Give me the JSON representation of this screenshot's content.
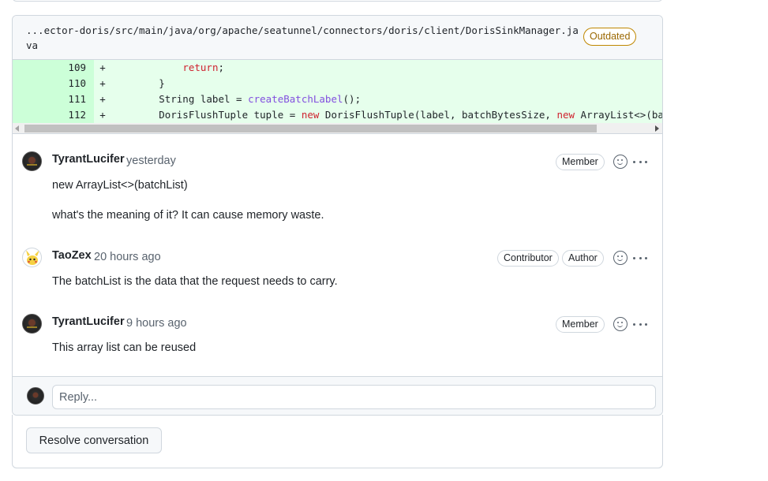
{
  "file": {
    "path": "...ector-doris/src/main/java/org/apache/seatunnel/connectors/doris/client/DorisSinkManager.java",
    "status_badge": "Outdated"
  },
  "diff": {
    "lines": [
      {
        "num": "109",
        "marker": "+",
        "tokens": [
          {
            "t": "            ",
            "c": ""
          },
          {
            "t": "return",
            "c": "kw"
          },
          {
            "t": ";",
            "c": ""
          }
        ]
      },
      {
        "num": "110",
        "marker": "+",
        "tokens": [
          {
            "t": "        }",
            "c": ""
          }
        ]
      },
      {
        "num": "111",
        "marker": "+",
        "tokens": [
          {
            "t": "        String label = ",
            "c": ""
          },
          {
            "t": "createBatchLabel",
            "c": "fn"
          },
          {
            "t": "();",
            "c": ""
          }
        ]
      },
      {
        "num": "112",
        "marker": "+",
        "tokens": [
          {
            "t": "        DorisFlushTuple tuple = ",
            "c": ""
          },
          {
            "t": "new",
            "c": "kw"
          },
          {
            "t": " DorisFlushTuple(label, batchBytesSize, ",
            "c": ""
          },
          {
            "t": "new",
            "c": "kw"
          },
          {
            "t": " ArrayList<>(bat",
            "c": ""
          }
        ]
      }
    ]
  },
  "comments": [
    {
      "author": "TyrantLucifer",
      "time": "yesterday",
      "badges": [
        "Member"
      ],
      "paragraphs": [
        "new ArrayList<>(batchList)",
        "what's the meaning of it? It can cause memory waste."
      ]
    },
    {
      "author": "TaoZex",
      "time": "20 hours ago",
      "badges": [
        "Contributor",
        "Author"
      ],
      "paragraphs": [
        "The batchList is the data that the request needs to carry."
      ]
    },
    {
      "author": "TyrantLucifer",
      "time": "9 hours ago",
      "badges": [
        "Member"
      ],
      "paragraphs": [
        "This array list can be reused"
      ]
    }
  ],
  "reply": {
    "placeholder": "Reply..."
  },
  "resolve": {
    "label": "Resolve conversation"
  }
}
